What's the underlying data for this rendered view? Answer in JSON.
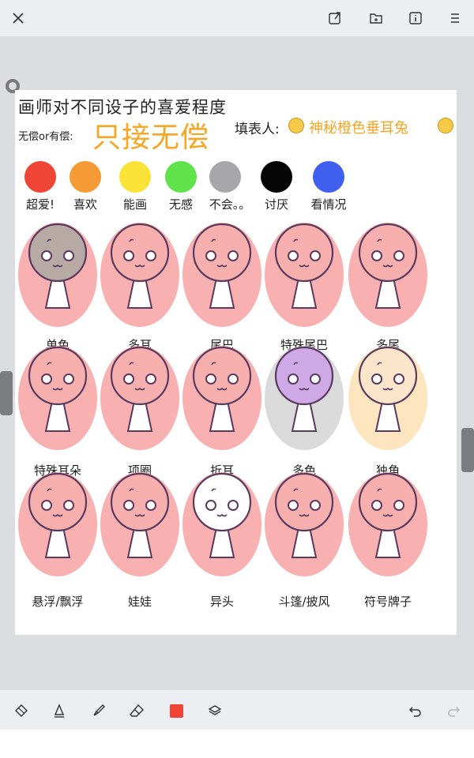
{
  "toolbar_top": {
    "icons": [
      "close-icon",
      "export-icon",
      "folder-icon",
      "info-icon",
      "menu-icon"
    ]
  },
  "sheet": {
    "title": "画师对不同设子的喜爱程度",
    "paid_label": "无偿or有偿:",
    "paid_value": "只接无偿",
    "filler_label": "填表人:",
    "filler_name": "神秘橙色垂耳兔"
  },
  "legend": [
    {
      "label": "超爱!",
      "color": "#ef4436"
    },
    {
      "label": "喜欢",
      "color": "#f59a35"
    },
    {
      "label": "能画",
      "color": "#fbe236"
    },
    {
      "label": "无感",
      "color": "#5fe24a"
    },
    {
      "label": "不会。。",
      "color": "#a7a7a9"
    },
    {
      "label": "讨厌",
      "color": "#050505"
    },
    {
      "label": "看情况",
      "color": "#3f5fee"
    }
  ],
  "characters": [
    {
      "label": "单色",
      "rating_color": "#f7a2a2",
      "fill": "#b7aaa5"
    },
    {
      "label": "多耳",
      "rating_color": "#f7a2a2",
      "fill": "#f7b0ae"
    },
    {
      "label": "尾巴",
      "rating_color": "#f7a2a2",
      "fill": "#f7b0ae"
    },
    {
      "label": "特殊尾巴",
      "rating_color": "#f7a2a2",
      "fill": "#f7b0ae"
    },
    {
      "label": "多尾",
      "rating_color": "#f7a2a2",
      "fill": "#f7b0ae"
    },
    {
      "label": "特殊耳朵",
      "rating_color": "#f7a2a2",
      "fill": "#f7b0ae"
    },
    {
      "label": "项圈",
      "rating_color": "#f7a2a2",
      "fill": "#f7b0ae"
    },
    {
      "label": "折耳",
      "rating_color": "#f7a2a2",
      "fill": "#f7b0ae"
    },
    {
      "label": "多色",
      "rating_color": "#d3d3d5",
      "fill": "#cfa8e6"
    },
    {
      "label": "独角",
      "rating_color": "#fbe0b4",
      "fill": "#fbe6cc"
    },
    {
      "label": "悬浮/飘浮",
      "rating_color": "#f7a2a2",
      "fill": "#f7b0ae"
    },
    {
      "label": "娃娃",
      "rating_color": "#f7a2a2",
      "fill": "#f7b0ae"
    },
    {
      "label": "异头",
      "rating_color": "#f7a2a2",
      "fill": "#ffffff"
    },
    {
      "label": "斗篷/披风",
      "rating_color": "#f7a2a2",
      "fill": "#f7b0ae"
    },
    {
      "label": "符号牌子",
      "rating_color": "#f7a2a2",
      "fill": "#f7b0ae"
    }
  ],
  "toolbar_bottom": {
    "tools": [
      "lasso-tool-icon",
      "pen-tool-icon",
      "brush-tool-icon",
      "eraser-tool-icon",
      "color-swatch",
      "layers-icon"
    ],
    "active_color": "#ef4436",
    "actions": [
      "undo-icon",
      "redo-icon"
    ]
  }
}
